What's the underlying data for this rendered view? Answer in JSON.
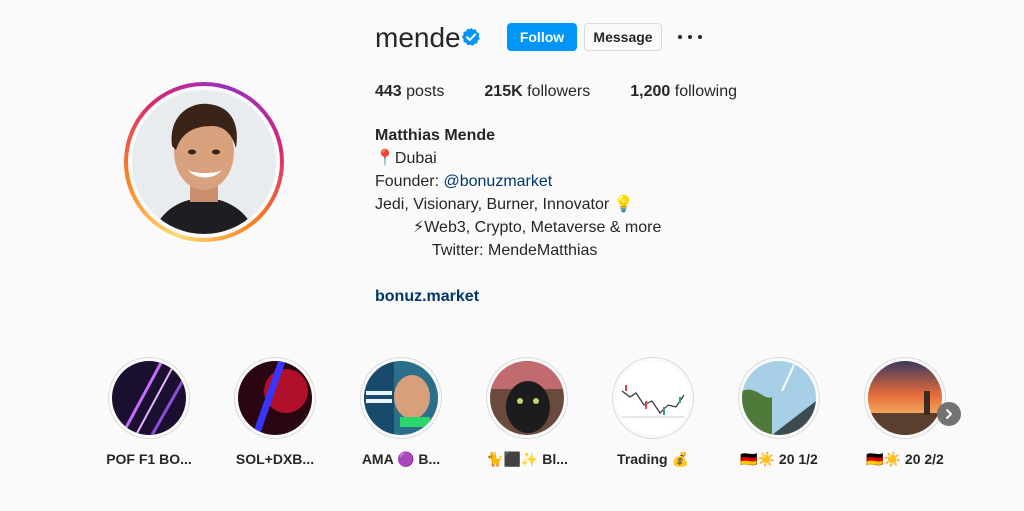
{
  "profile": {
    "username": "mende",
    "follow_label": "Follow",
    "message_label": "Message"
  },
  "stats": {
    "posts_count": "443",
    "posts_label": "posts",
    "followers_count": "215K",
    "followers_label": "followers",
    "following_count": "1,200",
    "following_label": "following"
  },
  "bio": {
    "name": "Matthias Mende",
    "location": "📍Dubai",
    "founder_prefix": "Founder: ",
    "founder_link": "@bonuzmarket",
    "line3": "Jedi, Visionary, Burner, Innovator 💡",
    "line4": "⚡Web3, Crypto, Metaverse & more",
    "line5": "Twitter: MendeMatthias",
    "website": "bonuz.market"
  },
  "highlights": [
    {
      "label": "POF F1 BO..."
    },
    {
      "label": "SOL+DXB..."
    },
    {
      "label": "AMA 🟣 B..."
    },
    {
      "label": "🐈⬛✨ Bl..."
    },
    {
      "label": "Trading 💰"
    },
    {
      "label": "🇩🇪☀️ 20 1/2"
    },
    {
      "label": "🇩🇪☀️ 20 2/2"
    }
  ],
  "colors": {
    "accent": "#0095f6",
    "link": "#00376b",
    "ring_gradient": [
      "#feda75",
      "#fa7e1e",
      "#d62976",
      "#962fbf"
    ]
  },
  "icons": [
    "verified-badge-icon",
    "more-options-icon",
    "chevron-right-icon"
  ]
}
